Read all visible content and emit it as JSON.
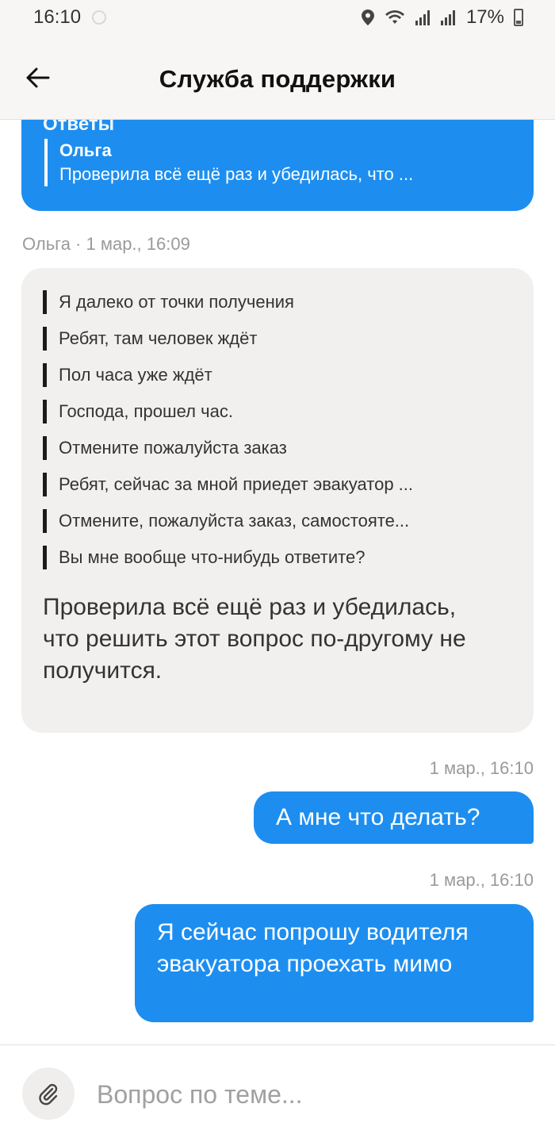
{
  "status_bar": {
    "time": "16:10",
    "battery": "17%"
  },
  "header": {
    "title": "Служба поддержки"
  },
  "chat": {
    "top_bubble": {
      "cut_text": "Ответы",
      "quote_author": "Ольга",
      "quote_text": "Проверила всё ещё раз и убедилась, что ..."
    },
    "agent_meta": "Ольга · 1 мар., 16:09",
    "agent_bubble": {
      "quotes": [
        "Я далеко от точки получения",
        "Ребят, там человек ждёт",
        "Пол часа уже ждёт",
        "Господа, прошел час.",
        "Отмените пожалуйста заказ",
        "Ребят, сейчас за мной приедет эвакуатор ...",
        "Отмените, пожалуйста заказ, самостояте...",
        "Вы мне вообще что-нибудь ответите?"
      ],
      "text": "Проверила всё ещё раз и убедилась, что решить этот вопрос по-другому не получится."
    },
    "user_messages": [
      {
        "meta": "1 мар., 16:10",
        "text": "А мне что делать?"
      },
      {
        "meta": "1 мар., 16:10",
        "text": "Я сейчас попрошу водителя эвакуатора проехать мимо"
      }
    ]
  },
  "composer": {
    "placeholder": "Вопрос по теме..."
  },
  "colors": {
    "accent": "#1d8ef0",
    "agent_bubble": "#f1f0ee"
  }
}
